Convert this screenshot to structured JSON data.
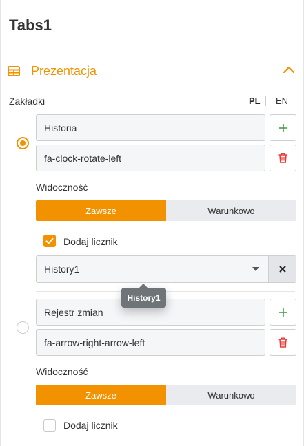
{
  "widget": {
    "title": "Tabs1"
  },
  "section": {
    "title": "Prezentacja",
    "icon": "table-icon",
    "toggle_icon": "chevron-up-icon"
  },
  "tabs_label": "Zakładki",
  "languages": {
    "active": "PL",
    "other": "EN"
  },
  "colors": {
    "accent": "#f39200",
    "danger": "#e53935",
    "success": "#43a047"
  },
  "tabs": [
    {
      "selected": true,
      "name": "Historia",
      "icon": "fa-clock-rotate-left",
      "visibility_label": "Widoczność",
      "visibility_options": [
        "Zawsze",
        "Warunkowo"
      ],
      "visibility_selected": "Zawsze",
      "counter_label": "Dodaj licznik",
      "counter_checked": true,
      "counter_source": "History1"
    },
    {
      "selected": false,
      "name": "Rejestr zmian",
      "icon": "fa-arrow-right-arrow-left",
      "visibility_label": "Widoczność",
      "visibility_options": [
        "Zawsze",
        "Warunkowo"
      ],
      "visibility_selected": "Zawsze",
      "counter_label": "Dodaj licznik",
      "counter_checked": false
    }
  ],
  "tooltip": "History1"
}
